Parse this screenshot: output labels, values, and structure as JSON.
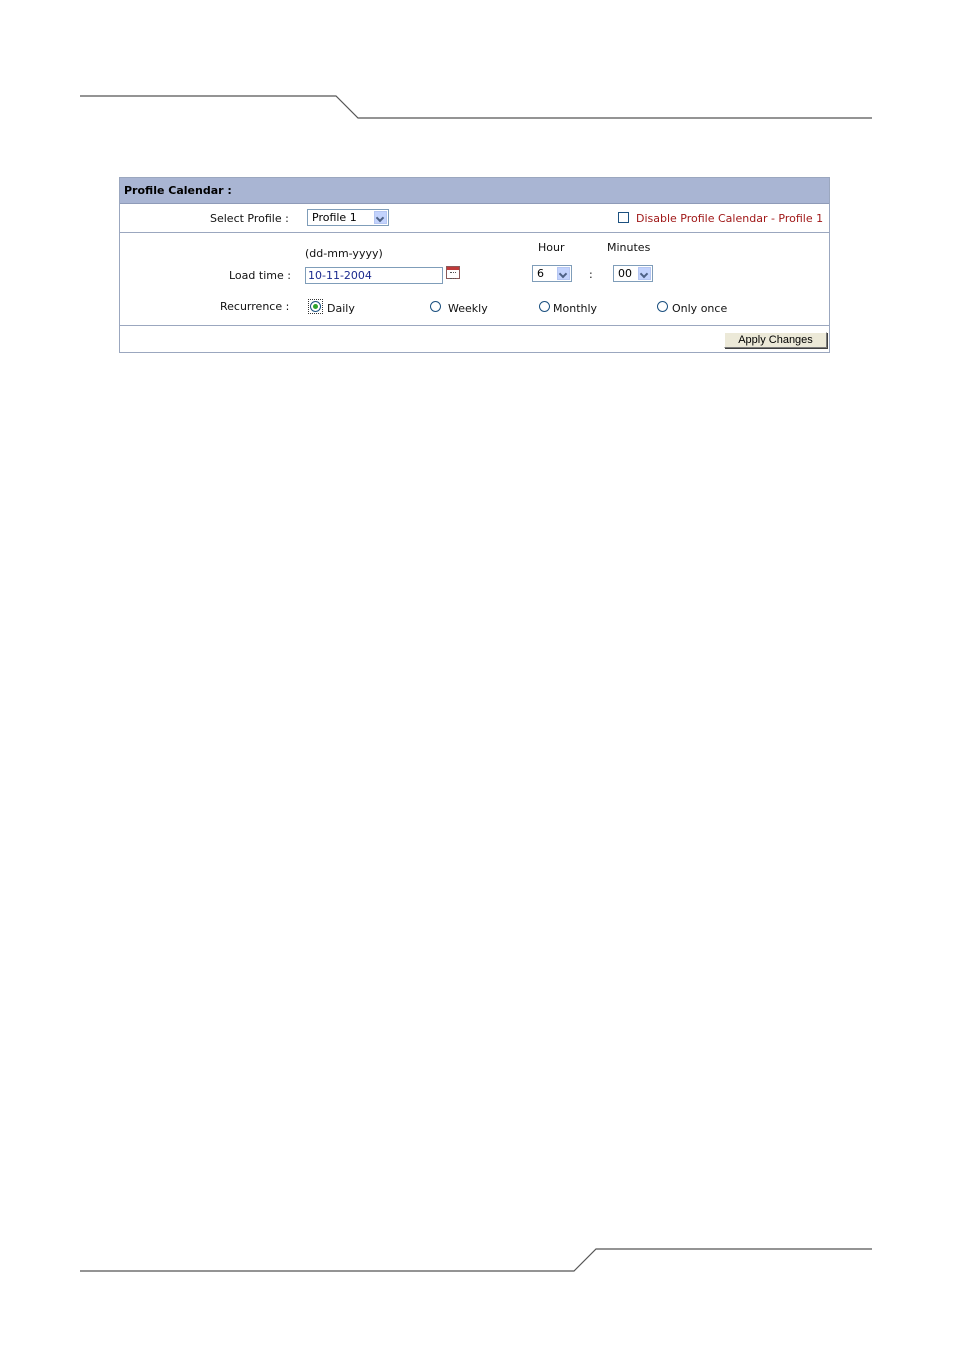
{
  "panel": {
    "title": "Profile Calendar :",
    "select_profile": {
      "label": "Select Profile :",
      "value": "Profile 1"
    },
    "disable_calendar": {
      "label": "Disable Profile Calendar - Profile 1",
      "checked": false
    },
    "load_time": {
      "label": "Load time :",
      "format_hint": "(dd-mm-yyyy)",
      "date_value": "10-11-2004",
      "hour_header": "Hour",
      "hour_value": "6",
      "separator": ":",
      "minutes_header": "Minutes",
      "minutes_value": "00"
    },
    "recurrence": {
      "label": "Recurrence :",
      "options": [
        "Daily",
        "Weekly",
        "Monthly",
        "Only once"
      ],
      "selected": "Daily"
    },
    "apply_button": "Apply Changes"
  },
  "colors": {
    "header_bg": "#a9b5d3",
    "border": "#9ba7bf",
    "disable_label": "#a01818",
    "date_text": "#1b2a8e"
  }
}
